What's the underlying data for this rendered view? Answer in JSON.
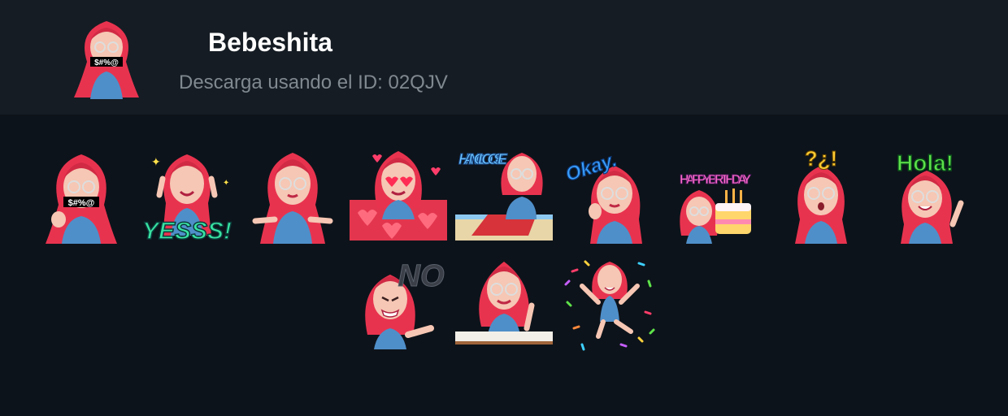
{
  "pack": {
    "title": "Bebeshita",
    "id_line": "Descarga usando el ID: 02QJV"
  },
  "colors": {
    "header_bg": "#151c23",
    "page_bg": "#0d131a",
    "hair": "#e8334f",
    "skin": "#f6c7b4",
    "denim": "#4f8fc9"
  },
  "stickers": [
    {
      "name": "censored-swear",
      "caption": "$#%@"
    },
    {
      "name": "yesss",
      "caption": "YESSS!"
    },
    {
      "name": "shrug",
      "caption": ""
    },
    {
      "name": "heart-eyes",
      "caption": ""
    },
    {
      "name": "hang-loose",
      "caption": "HANG LOOSE"
    },
    {
      "name": "okay",
      "caption": "Okay."
    },
    {
      "name": "happy-birthday",
      "caption": "HAPPY BIRTHDAY"
    },
    {
      "name": "confused",
      "caption": "?¿!"
    },
    {
      "name": "hola",
      "caption": "Hola!"
    },
    {
      "name": "no",
      "caption": "NO"
    },
    {
      "name": "wave-at-desk",
      "caption": ""
    },
    {
      "name": "confetti-jump",
      "caption": ""
    }
  ]
}
